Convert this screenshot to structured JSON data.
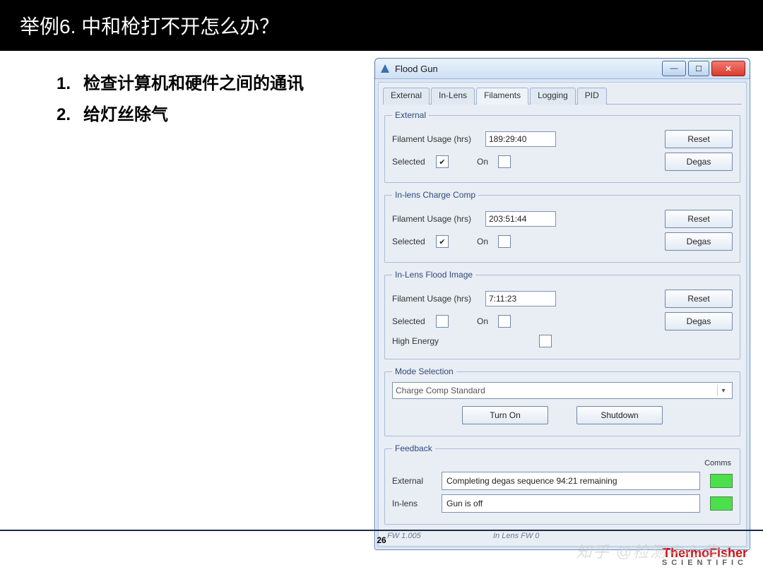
{
  "slide": {
    "title": "举例6. 中和枪打不开怎么办？",
    "bullets": [
      "检查计算机和硬件之间的通讯",
      "给灯丝除气"
    ],
    "page_number": "26"
  },
  "brand": {
    "line1_a": "ThermoFisher",
    "line2": "SCIENTIFIC"
  },
  "watermark": "知乎 @检测中心黄工",
  "window": {
    "title": "Flood Gun",
    "tabs": [
      "External",
      "In-Lens",
      "Filaments",
      "Logging",
      "PID"
    ],
    "active_tab": 2,
    "groups": {
      "external": {
        "legend": "External",
        "usage_label": "Filament Usage (hrs)",
        "usage_value": "189:29:40",
        "selected_label": "Selected",
        "selected_checked": true,
        "on_label": "On",
        "on_checked": false,
        "reset": "Reset",
        "degas": "Degas"
      },
      "inlens_cc": {
        "legend": "In-lens Charge Comp",
        "usage_label": "Filament Usage (hrs)",
        "usage_value": "203:51:44",
        "selected_label": "Selected",
        "selected_checked": true,
        "on_label": "On",
        "on_checked": false,
        "reset": "Reset",
        "degas": "Degas"
      },
      "inlens_fi": {
        "legend": "In-Lens Flood Image",
        "usage_label": "Filament Usage (hrs)",
        "usage_value": "7:11:23",
        "selected_label": "Selected",
        "selected_checked": false,
        "on_label": "On",
        "on_checked": false,
        "high_energy_label": "High Energy",
        "high_energy_checked": false,
        "reset": "Reset",
        "degas": "Degas"
      },
      "mode": {
        "legend": "Mode Selection",
        "selected": "Charge Comp Standard",
        "turn_on": "Turn On",
        "shutdown": "Shutdown"
      },
      "feedback": {
        "legend": "Feedback",
        "comms_label": "Comms",
        "external_label": "External",
        "external_status": "Completing degas sequence 94:21 remaining",
        "inlens_label": "In-lens",
        "inlens_status": "Gun is off"
      }
    },
    "fw": {
      "left": "FW 1.005",
      "right": "In Lens FW 0"
    }
  }
}
